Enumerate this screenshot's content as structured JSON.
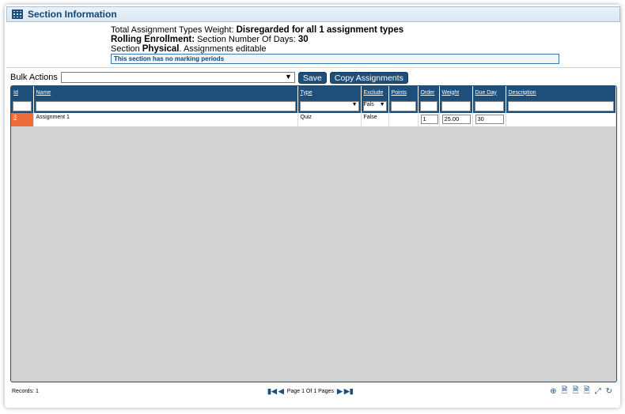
{
  "section": {
    "title": "Section Information"
  },
  "info": {
    "weight_label": "Total Assignment Types Weight:",
    "weight_value": "Disregarded for all 1 assignment types",
    "rolling_label": "Rolling Enrollment:",
    "days_label": "Section Number Of Days:",
    "days_value": "30",
    "section_word": "Section",
    "section_type": "Physical",
    "section_suffix": ". Assignments editable"
  },
  "notice": "This section has no marking periods",
  "bulk": {
    "label": "Bulk Actions",
    "selected": ""
  },
  "buttons": {
    "save": "Save",
    "copy": "Copy Assignments"
  },
  "grid": {
    "columns": [
      "Id",
      "Name",
      "Type",
      "Exclude",
      "Points",
      "Order",
      "Weight",
      "Due Day",
      "Description"
    ],
    "filters": {
      "type": "",
      "exclude": "Fals"
    },
    "rows": [
      {
        "id": "3",
        "name": "Assignment 1",
        "type": "Quiz",
        "exclude": "False",
        "points": "",
        "order": "1",
        "weight": "25.00",
        "due_day": "30",
        "description": ""
      }
    ]
  },
  "footer": {
    "records": "Records: 1",
    "page_text": "Page 1 Of 1 Pages"
  },
  "colors": {
    "accent": "#1d4f7a",
    "id_highlight": "#ef6d3a",
    "grid_bg": "#d3d3d3"
  },
  "icons": [
    "grid-icon",
    "first-page-icon",
    "prev-page-icon",
    "next-page-icon",
    "last-page-icon",
    "add-icon",
    "export-icon",
    "export-excel-icon",
    "export-pdf-icon",
    "collapse-icon",
    "refresh-icon"
  ]
}
